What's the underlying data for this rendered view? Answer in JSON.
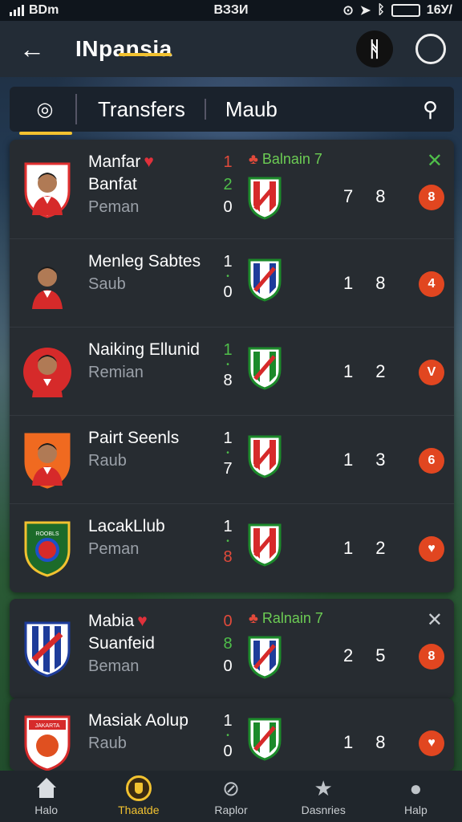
{
  "status_bar": {
    "carrier": "ВDm",
    "time": "ВЗЗИ",
    "battery_text": "16У/"
  },
  "app_bar": {
    "title": "INpansia",
    "action_label": "ᚻ"
  },
  "tabs": {
    "items": [
      {
        "label": "Transfers"
      },
      {
        "label": "Maub"
      }
    ]
  },
  "rows_group1": [
    {
      "name1": "Manfar",
      "heart": true,
      "name2": "Banfat",
      "name3": "Peman",
      "scores": [
        {
          "v": "1",
          "c": "red"
        },
        {
          "v": "2",
          "c": "green"
        },
        {
          "v": "0",
          "c": ""
        }
      ],
      "opp_label": "Balnain 7",
      "nums": [
        "7",
        "8"
      ],
      "badge": "8",
      "close": true,
      "crest": "player-red"
    },
    {
      "name1": "Menleg Sabtes",
      "heart": false,
      "name2": "",
      "name3": "Saub",
      "scores": [
        {
          "v": "1",
          "c": ""
        },
        {
          "v": "•",
          "c": "dot"
        },
        {
          "v": "0",
          "c": ""
        }
      ],
      "opp_label": "",
      "nums": [
        "1",
        "8"
      ],
      "badge": "4",
      "close": false,
      "crest": "player-plain"
    },
    {
      "name1": "Naiking Ellunid",
      "heart": false,
      "name2": "",
      "name3": "Remian",
      "scores": [
        {
          "v": "1",
          "c": "green"
        },
        {
          "v": "•",
          "c": "dot"
        },
        {
          "v": "8",
          "c": ""
        }
      ],
      "opp_label": "",
      "nums": [
        "1",
        "2"
      ],
      "badge": "V",
      "close": false,
      "crest": "player-red2"
    },
    {
      "name1": "Pairt Seenls",
      "heart": false,
      "name2": "",
      "name3": "Raub",
      "scores": [
        {
          "v": "1",
          "c": ""
        },
        {
          "v": "•",
          "c": "dot"
        },
        {
          "v": "7",
          "c": ""
        }
      ],
      "opp_label": "",
      "nums": [
        "1",
        "3"
      ],
      "badge": "6",
      "close": false,
      "crest": "player-orange"
    },
    {
      "name1": "LacakLlub",
      "heart": false,
      "name2": "",
      "name3": "Peman",
      "scores": [
        {
          "v": "1",
          "c": ""
        },
        {
          "v": "•",
          "c": "dot"
        },
        {
          "v": "8",
          "c": "red"
        }
      ],
      "opp_label": "",
      "nums": [
        "1",
        "2"
      ],
      "badge": "♥",
      "close": false,
      "crest": "club-green"
    }
  ],
  "rows_group2": [
    {
      "name1": "Mabia",
      "heart": true,
      "name2": "Suanfeid",
      "name3": "Beman",
      "scores": [
        {
          "v": "0",
          "c": "red"
        },
        {
          "v": "8",
          "c": "green"
        },
        {
          "v": "0",
          "c": ""
        }
      ],
      "opp_label": "Ralnain 7",
      "nums": [
        "2",
        "5"
      ],
      "badge": "8",
      "close": true,
      "crest": "club-blue"
    }
  ],
  "rows_group3": [
    {
      "name1": "Masiak Aolup",
      "heart": false,
      "name2": "",
      "name3": "Raub",
      "scores": [
        {
          "v": "1",
          "c": ""
        },
        {
          "v": "•",
          "c": "dot"
        },
        {
          "v": "0",
          "c": ""
        }
      ],
      "opp_label": "",
      "nums": [
        "1",
        "8"
      ],
      "badge": "♥",
      "close": false,
      "crest": "club-red"
    }
  ],
  "bottom_nav": [
    {
      "label": "Halo",
      "icon": "home-icon",
      "active": false
    },
    {
      "label": "Thaatde",
      "icon": "trophy-icon",
      "active": true
    },
    {
      "label": "Raplor",
      "icon": "compass-icon",
      "active": false
    },
    {
      "label": "Dasnries",
      "icon": "star-icon",
      "active": false
    },
    {
      "label": "Halp",
      "icon": "person-icon",
      "active": false
    }
  ],
  "colors": {
    "accent": "#f2c230",
    "badge": "#e14620",
    "card": "#272c31",
    "score_red": "#e24a3b",
    "score_green": "#4fbf4a"
  }
}
